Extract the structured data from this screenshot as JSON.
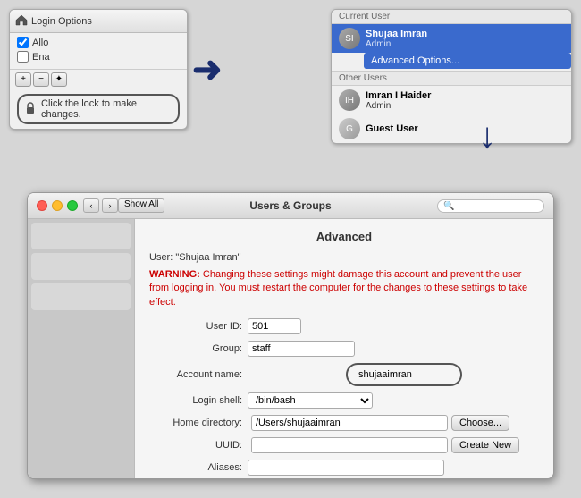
{
  "topLeft": {
    "title": "Login Options",
    "checkbox1": "Allo",
    "checkbox2": "Ena",
    "buttons": [
      "+",
      "−",
      "✦"
    ],
    "lockText": "Click the lock to make changes."
  },
  "topRight": {
    "currentUserLabel": "Current User",
    "currentUser": {
      "name": "Shujaa Imran",
      "role": "Admin",
      "contextMenu": "Advanced Options..."
    },
    "otherUsersLabel": "Other Users",
    "otherUsers": [
      {
        "name": "Imran I Haider",
        "role": "Admin"
      },
      {
        "name": "Guest User",
        "role": ""
      }
    ]
  },
  "arrows": {
    "right": "→",
    "down": "↓"
  },
  "dialog": {
    "title": "Users & Groups",
    "navBack": "‹",
    "navFwd": "›",
    "showAll": "Show All",
    "searchPlaceholder": "🔍",
    "sectionTitle": "Advanced",
    "userLabel": "User: \"Shujaa Imran\"",
    "warningLabel": "WARNING:",
    "warningText": "Changing these settings might damage this account and prevent the user from logging in. You must restart the computer for the changes to these settings to take effect.",
    "fields": {
      "userIdLabel": "User ID:",
      "userIdValue": "501",
      "groupLabel": "Group:",
      "groupValue": "staff",
      "accountNameLabel": "Account name:",
      "accountNameValue": "shujaaimran",
      "loginShellLabel": "Login shell:",
      "loginShellValue": "/bin/bash",
      "homeDirLabel": "Home directory:",
      "homeDirValue": "/Users/shujaaimran",
      "uuidLabel": "UUID:",
      "uuidValue": "",
      "aliasesLabel": "Aliases:"
    },
    "buttons": {
      "choose": "Choose...",
      "createNew": "Create New"
    }
  }
}
